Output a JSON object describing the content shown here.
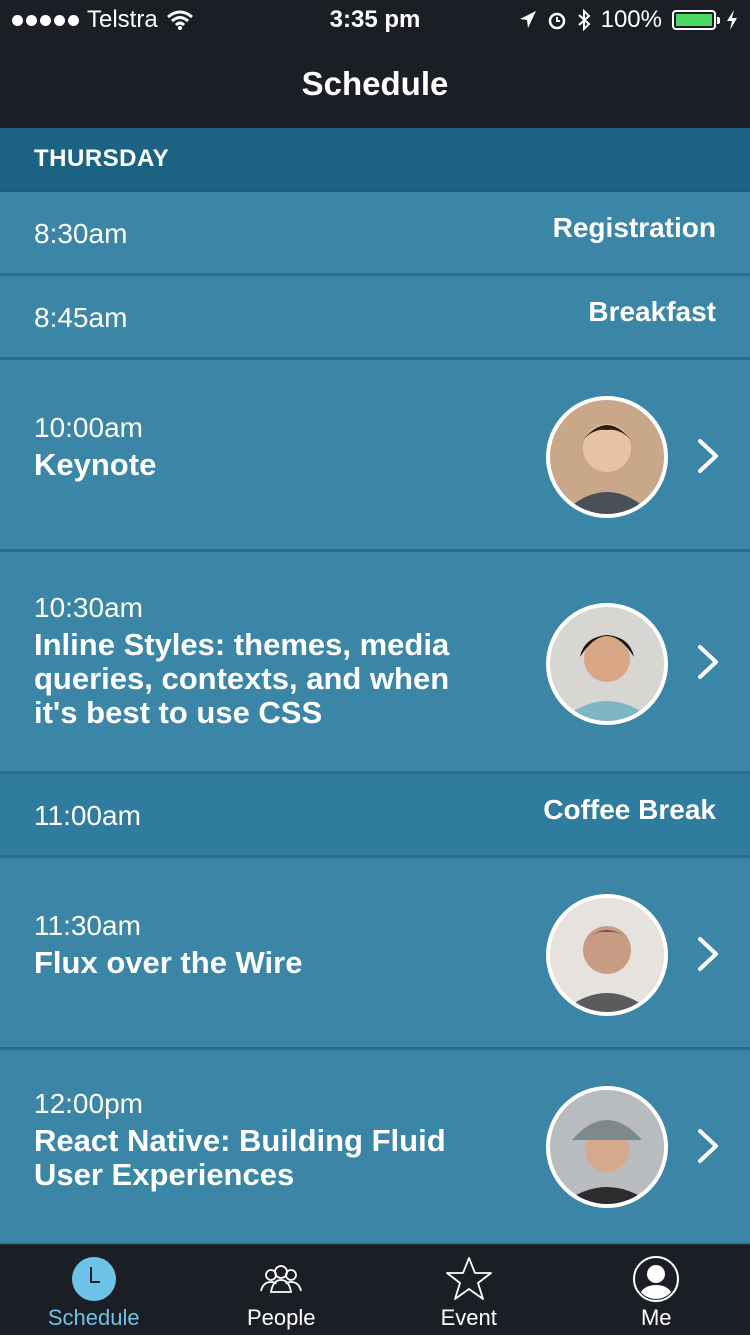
{
  "status": {
    "carrier": "Telstra",
    "time": "3:35 pm",
    "battery": "100%"
  },
  "nav": {
    "title": "Schedule"
  },
  "schedule": {
    "day": "THURSDAY",
    "rows": [
      {
        "time": "8:30am",
        "title": "Registration"
      },
      {
        "time": "8:45am",
        "title": "Breakfast"
      },
      {
        "time": "10:00am",
        "title": "Keynote"
      },
      {
        "time": "10:30am",
        "title": "Inline Styles: themes, media queries, contexts, and when it's best to use CSS"
      },
      {
        "time": "11:00am",
        "title": "Coffee Break"
      },
      {
        "time": "11:30am",
        "title": "Flux over the Wire"
      },
      {
        "time": "12:00pm",
        "title": "React Native: Building Fluid User Experiences"
      }
    ]
  },
  "tabs": [
    {
      "label": "Schedule",
      "icon": "clock-icon",
      "active": true
    },
    {
      "label": "People",
      "icon": "people-icon",
      "active": false
    },
    {
      "label": "Event",
      "icon": "star-icon",
      "active": false
    },
    {
      "label": "Me",
      "icon": "person-icon",
      "active": false
    }
  ],
  "colors": {
    "accent": "#6ec3e8",
    "row": "#3b86a6",
    "header": "#1c6383",
    "bar": "#1b1e24",
    "battery": "#4cd964"
  }
}
